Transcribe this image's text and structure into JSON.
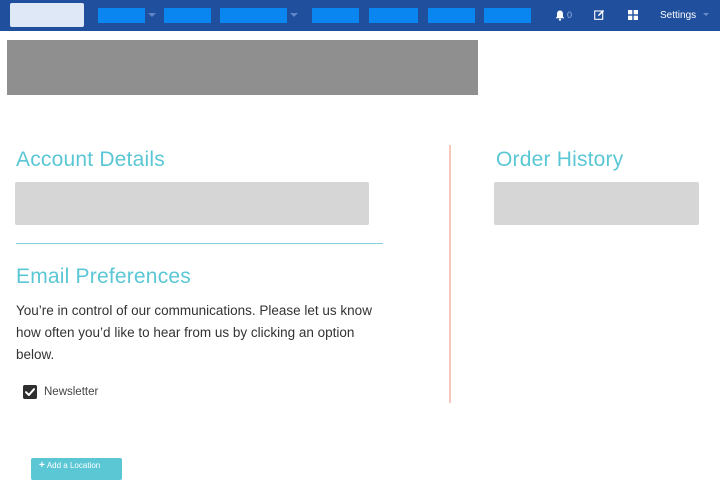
{
  "topnav": {
    "notification_count": "0",
    "settings_label": "Settings",
    "icons": [
      "bell-icon",
      "edit-icon",
      "grid-icon"
    ]
  },
  "account": {
    "heading": "Account Details"
  },
  "orders": {
    "heading": "Order History"
  },
  "email": {
    "heading": "Email Preferences",
    "description": "You’re in control of our communications. Please let us know how often you’d like to hear from us by clicking an option below.",
    "newsletter_label": "Newsletter",
    "newsletter_checked": true
  },
  "actions": {
    "add_location_label": "Add a Location"
  },
  "colors": {
    "nav_bg": "#1f4f9d",
    "nav_item": "#0a86f0",
    "accent": "#5bc7d5",
    "divider": "#f6c9bc",
    "placeholder": "#d6d6d6",
    "banner": "#8f8f8f"
  }
}
